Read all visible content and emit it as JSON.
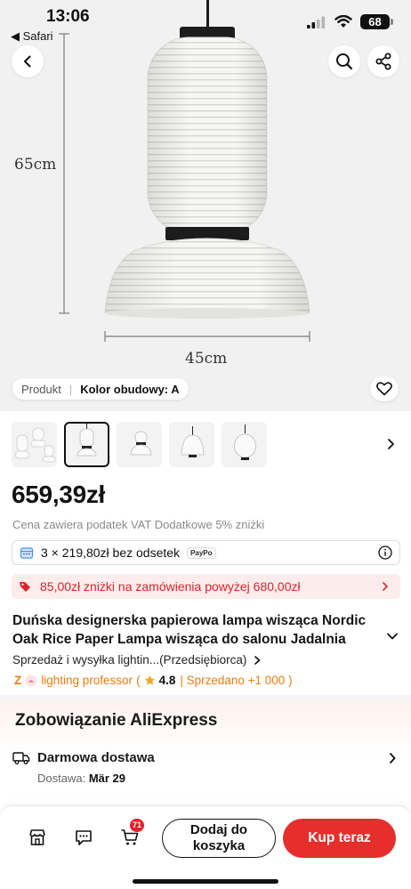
{
  "status_bar": {
    "time": "13:06",
    "back_app": "◀ Safari",
    "battery": "68"
  },
  "hero": {
    "height_label": "65cm",
    "width_label": "45cm",
    "chip": {
      "label": "Produkt",
      "separator": "|",
      "value": "Kolor obudowy: A"
    }
  },
  "icons": {
    "back": "chevron-left-icon",
    "search": "search-icon",
    "share": "share-icon",
    "wishlist": "heart-icon",
    "store": "store-icon",
    "chat": "chat-icon",
    "cart": "cart-icon"
  },
  "thumbnails": {
    "count": 5,
    "active_index": 1
  },
  "price": {
    "value": "659,39zł",
    "tax_note": "Cena zawiera podatek VAT Dodatkowe 5% zniżki"
  },
  "installments": {
    "text": "3 × 219,80zł bez odsetek",
    "provider": "PayPo"
  },
  "coupon": {
    "text": "85,00zł zniżki na zamówienia powyżej 680,00zł"
  },
  "product": {
    "title": "Duńska designerska papierowa lampa wisząca Nordic Oak Rice Paper Lampa wisząca do salonu Jadalnia Sypialnia",
    "seller_text": "Sprzedaż i wysyłka lightin...(Przedsiębiorca)"
  },
  "store": {
    "prefix": "Z",
    "name": "lighting professor",
    "open_paren": "(",
    "rating": "4.8",
    "sold": "| Sprzedano +1 000 )"
  },
  "commitment": {
    "title": "Zobowiązanie AliExpress",
    "shipping_title": "Darmowa dostawa",
    "delivery_label": "Dostawa:",
    "delivery_date": "Mär 29"
  },
  "bottom_bar": {
    "cart_count": "71",
    "add_to_cart_line1": "Dodaj do",
    "add_to_cart_line2": "koszyka",
    "buy_now": "Kup teraz"
  },
  "colors": {
    "accent_red": "#e62e2b",
    "coupon_bg": "#fdecec",
    "store_orange": "#e87c13"
  }
}
